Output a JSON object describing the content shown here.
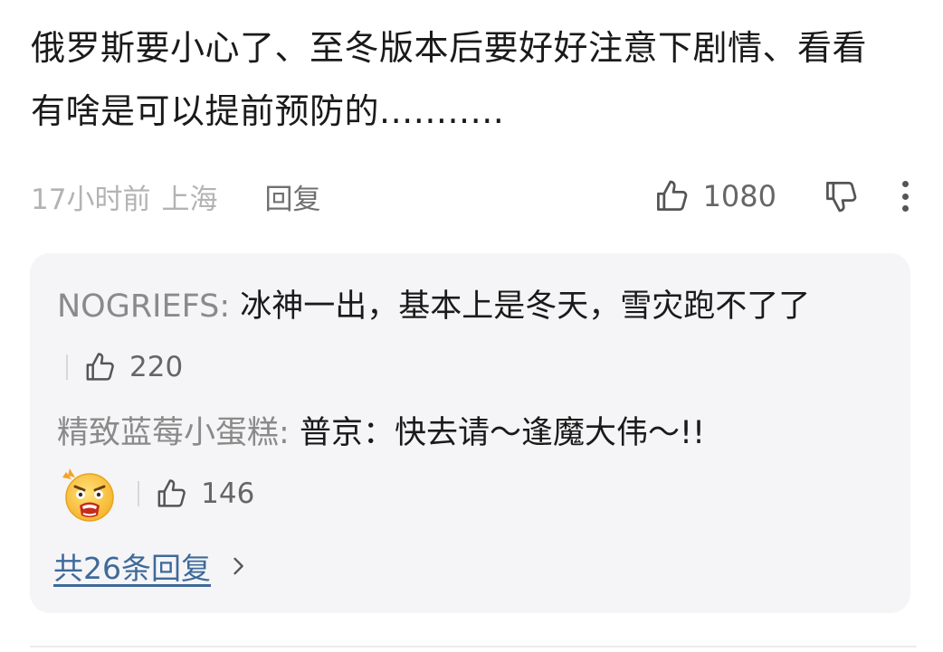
{
  "comment": {
    "text": "俄罗斯要小心了、至冬版本后要好好注意下剧情、看看有啥是可以提前预防的...........",
    "time": "17小时前",
    "location": "上海",
    "reply_label": "回复",
    "like_count": "1080",
    "icons": {
      "like": "thumbs-up-icon",
      "dislike": "thumbs-down-icon",
      "more": "more-vertical-icon"
    }
  },
  "replies": [
    {
      "author": "NOGRIEFS",
      "separator": ": ",
      "content": "冰神一出，基本上是冬天，雪灾跑不了了",
      "like_count": "220"
    },
    {
      "author": "精致蓝莓小蛋糕",
      "separator": ": ",
      "content": "普京：快去请～逢魔大伟～!!",
      "emoji": "shocked-face-emoji",
      "like_count": "146"
    }
  ],
  "view_all": {
    "label": "共26条回复",
    "icon": "chevron-right-icon"
  },
  "colors": {
    "text": "#1a1a1a",
    "muted": "#b3b3b3",
    "author": "#8a8a8a",
    "link": "#3f6a9a",
    "reply_bg": "#f5f5f7"
  }
}
